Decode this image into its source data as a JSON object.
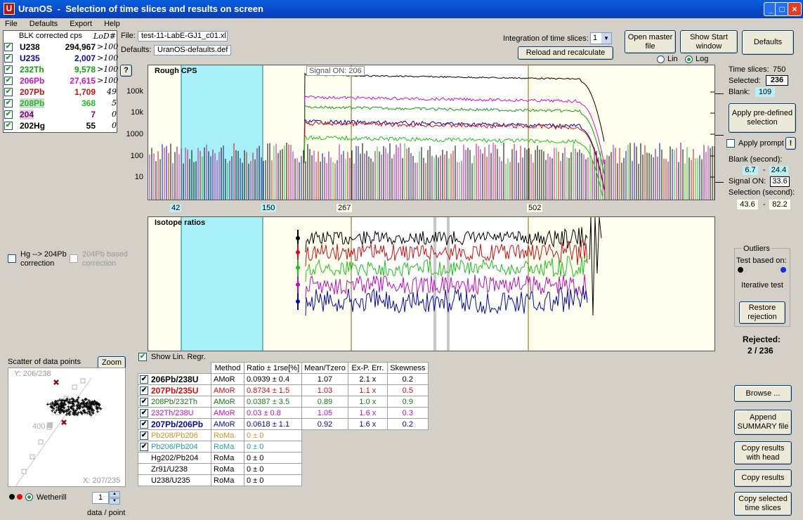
{
  "window": {
    "title": "UranOS  -  Selection of time slices and results on screen",
    "icon": "U"
  },
  "menu": [
    "File",
    "Defaults",
    "Export",
    "Help"
  ],
  "blk": {
    "header": "BLK corrected cps",
    "lod_header": "LoD#",
    "rows": [
      {
        "name": "U238",
        "value": "294,967",
        "lod": ">100",
        "color": "#000000"
      },
      {
        "name": "U235",
        "value": "2,007",
        "lod": ">100",
        "color": "#0a0aa8"
      },
      {
        "name": "232Th",
        "value": "9,578",
        "lod": ">100",
        "color": "#10a010"
      },
      {
        "name": "206Pb",
        "value": "27,615",
        "lod": ">100",
        "color": "#d010d0"
      },
      {
        "name": "207Pb",
        "value": "1,709",
        "lod": "49",
        "color": "#d01010"
      },
      {
        "name": "208Pb",
        "value": "368",
        "lod": "5",
        "color": "#20c020"
      },
      {
        "name": "204",
        "value": "7",
        "lod": "0",
        "color": "#800080"
      },
      {
        "name": "202Hg",
        "value": "55",
        "lod": "0",
        "color": "#000000"
      }
    ]
  },
  "file": {
    "label": "File:",
    "value": "test-11-LabE-GJ1_c01.xl",
    "defaults_label": "Defaults:",
    "defaults_value": "UranOS-defaults.def"
  },
  "integration": {
    "label": "Integration of time slices:",
    "value": "1"
  },
  "buttons": {
    "reload": "Reload and recalculate",
    "open_master": "Open master file",
    "show_start": "Show Start window",
    "defaults": "Defaults",
    "help": "?",
    "apply_predef": "Apply pre-defined selection",
    "apply_prompt_excl": "!",
    "restore": "Restore rejection",
    "zoom": "Zoom",
    "browse": "Browse ...",
    "append": "Append SUMMARY file",
    "copy_head": "Copy results with head",
    "copy": "Copy results",
    "copy_sel": "Copy selected time slices"
  },
  "scale": {
    "lin": "Lin",
    "log": "Log",
    "selected": "log"
  },
  "cps_chart": {
    "title": "Rough CPS",
    "signal_on": "Signal ON:  206",
    "y_ticks": [
      "100k",
      "10k",
      "1000",
      "100",
      "10"
    ],
    "x_markers": [
      "42",
      "150",
      "267",
      "502"
    ]
  },
  "ratio_chart": {
    "title": "Isotope ratios"
  },
  "time_info": {
    "slices_label": "Time slices:",
    "slices_value": "750",
    "selected_label": "Selected:",
    "selected_value": "236",
    "blank_label": "Blank:",
    "blank_value": "109",
    "apply_prompt": "Apply prompt",
    "blank_sec_label": "Blank (second):",
    "blank_from": "6.7",
    "blank_to": "24.4",
    "signal_label": "Signal ON:",
    "signal_value": "33.6",
    "selection_label": "Selection (second):",
    "sel_from": "43.6",
    "sel_to": "82.2",
    "dash": "-"
  },
  "corrections": {
    "hg": "Hg --> 204Pb correction",
    "pb204": "204Pb based correction"
  },
  "outliers": {
    "title": "Outliers",
    "test_based": "Test based on:",
    "iterative": "Iterative test",
    "rejected_label": "Rejected:",
    "rejected_value": "2 / 236"
  },
  "scatter": {
    "title": "Scatter of data points",
    "y_label": "Y: 206/238",
    "x_label": "X: 207/235",
    "tick": "400",
    "mode": "Wetherill",
    "data_per_point_label": "data / point",
    "data_per_point": "1"
  },
  "show_lin_regr": "Show Lin. Regr.",
  "results": {
    "headers": [
      "Method",
      "Ratio ± 1rse[%]",
      "Mean/Tzero",
      "Ex-P. Err.",
      "Skewness"
    ],
    "rows": [
      {
        "name": "206Pb/238U",
        "method": "AMoR",
        "ratio": "0.0939  ± 0.4",
        "mean": "1.07",
        "exp": "2.1 x",
        "skew": "0.2",
        "color": "#000000",
        "bold": true,
        "checked": true
      },
      {
        "name": "207Pb/235U",
        "method": "AMoR",
        "ratio": "0.8734  ± 1.5",
        "mean": "1.03",
        "exp": "1.1 x",
        "skew": "0.5",
        "color": "#d01010",
        "bold": true,
        "checked": true
      },
      {
        "name": "208Pb/232Th",
        "method": "AMoR",
        "ratio": "0.0387  ± 3.5",
        "mean": "0.89",
        "exp": "1.0 x",
        "skew": "0.9",
        "color": "#108010",
        "bold": false,
        "checked": true
      },
      {
        "name": "232Th/238U",
        "method": "AMoR",
        "ratio": "0.03  ± 0.8",
        "mean": "1.05",
        "exp": "1.6 x",
        "skew": "0.3",
        "color": "#c010c0",
        "bold": false,
        "checked": true
      },
      {
        "name": "207Pb/206Pb",
        "method": "AMoR",
        "ratio": "0.0618  ± 1.1",
        "mean": "0.92",
        "exp": "1.6 x",
        "skew": "0.2",
        "color": "#0a0a90",
        "bold": true,
        "checked": true
      },
      {
        "name": "Pb208/Pb206",
        "method": "RoMa",
        "ratio": "0  ± 0",
        "color": "#e09020",
        "checked": true
      },
      {
        "name": "Pb206/Pb204",
        "method": "RoMa",
        "ratio": "0  ± 0",
        "color": "#20a0b0",
        "checked": true
      },
      {
        "name": "Hg202/Pb204",
        "method": "RoMa",
        "ratio": "0  ± 0",
        "color": "#000000",
        "checked": false
      },
      {
        "name": "Zr91/U238",
        "method": "RoMa",
        "ratio": "0  ± 0",
        "color": "#000000",
        "checked": false
      },
      {
        "name": "U238/U235",
        "method": "RoMa",
        "ratio": "0  ± 0",
        "color": "#000000",
        "checked": false
      }
    ]
  },
  "colors": {
    "blank_region": "#a8f0f8",
    "cream": "#fffff0",
    "selection": "#ffffff"
  }
}
